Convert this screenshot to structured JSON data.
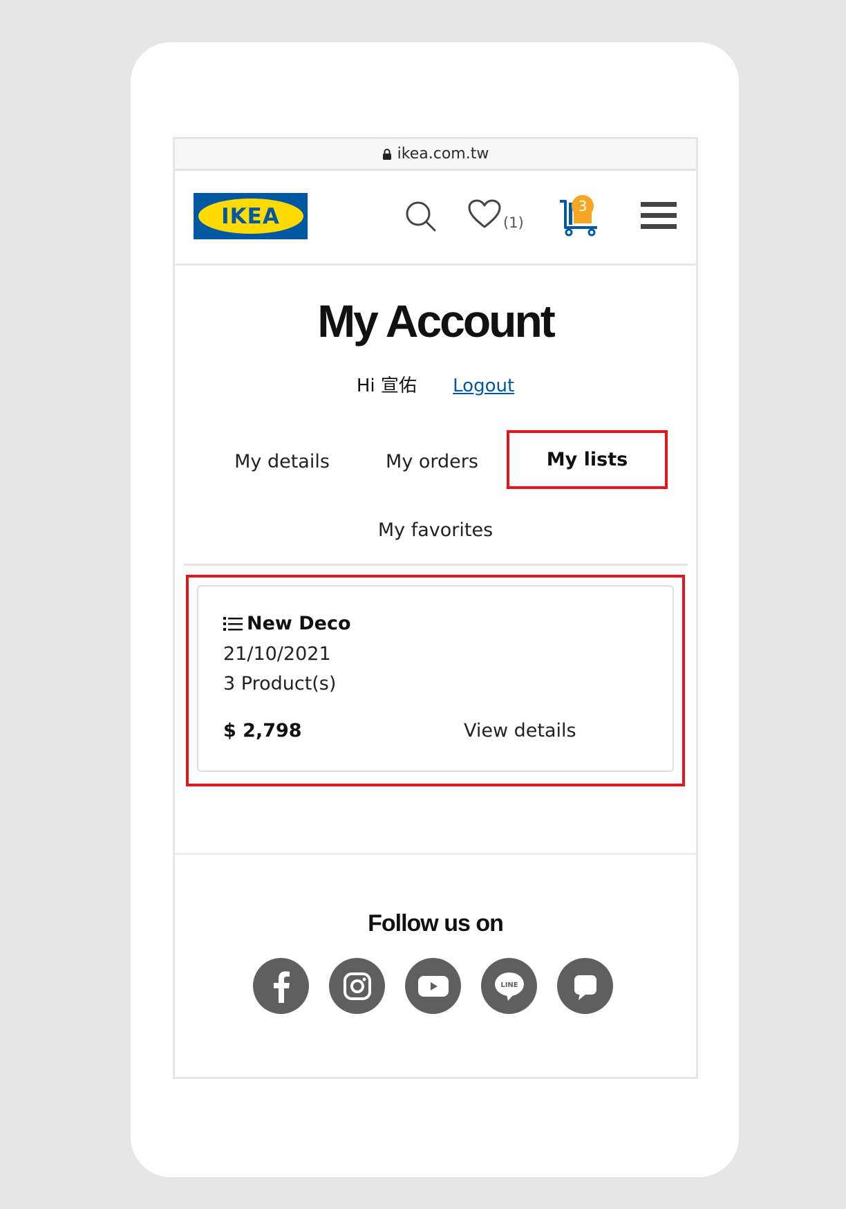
{
  "browser": {
    "url": "ikea.com.tw"
  },
  "header": {
    "logo_text": "IKEA",
    "favorites_count": "(1)",
    "cart_count": "3"
  },
  "page": {
    "title": "My Account",
    "greeting": "Hi 宣佑",
    "logout_label": "Logout"
  },
  "tabs": {
    "details": "My details",
    "orders": "My orders",
    "lists": "My lists",
    "favorites": "My favorites",
    "active": "My lists"
  },
  "list_card": {
    "name": "New Deco",
    "date": "21/10/2021",
    "products": "3 Product(s)",
    "price": "$ 2,798",
    "view_label": "View details"
  },
  "footer": {
    "follow_label": "Follow us on",
    "socials": [
      "facebook-icon",
      "instagram-icon",
      "youtube-icon",
      "line-icon",
      "chat-icon"
    ]
  },
  "colors": {
    "highlight": "#e8131b",
    "ikea_blue": "#0058a3",
    "ikea_yellow": "#ffdb00",
    "badge": "#f5a623",
    "social_bg": "#5f5f5f"
  }
}
